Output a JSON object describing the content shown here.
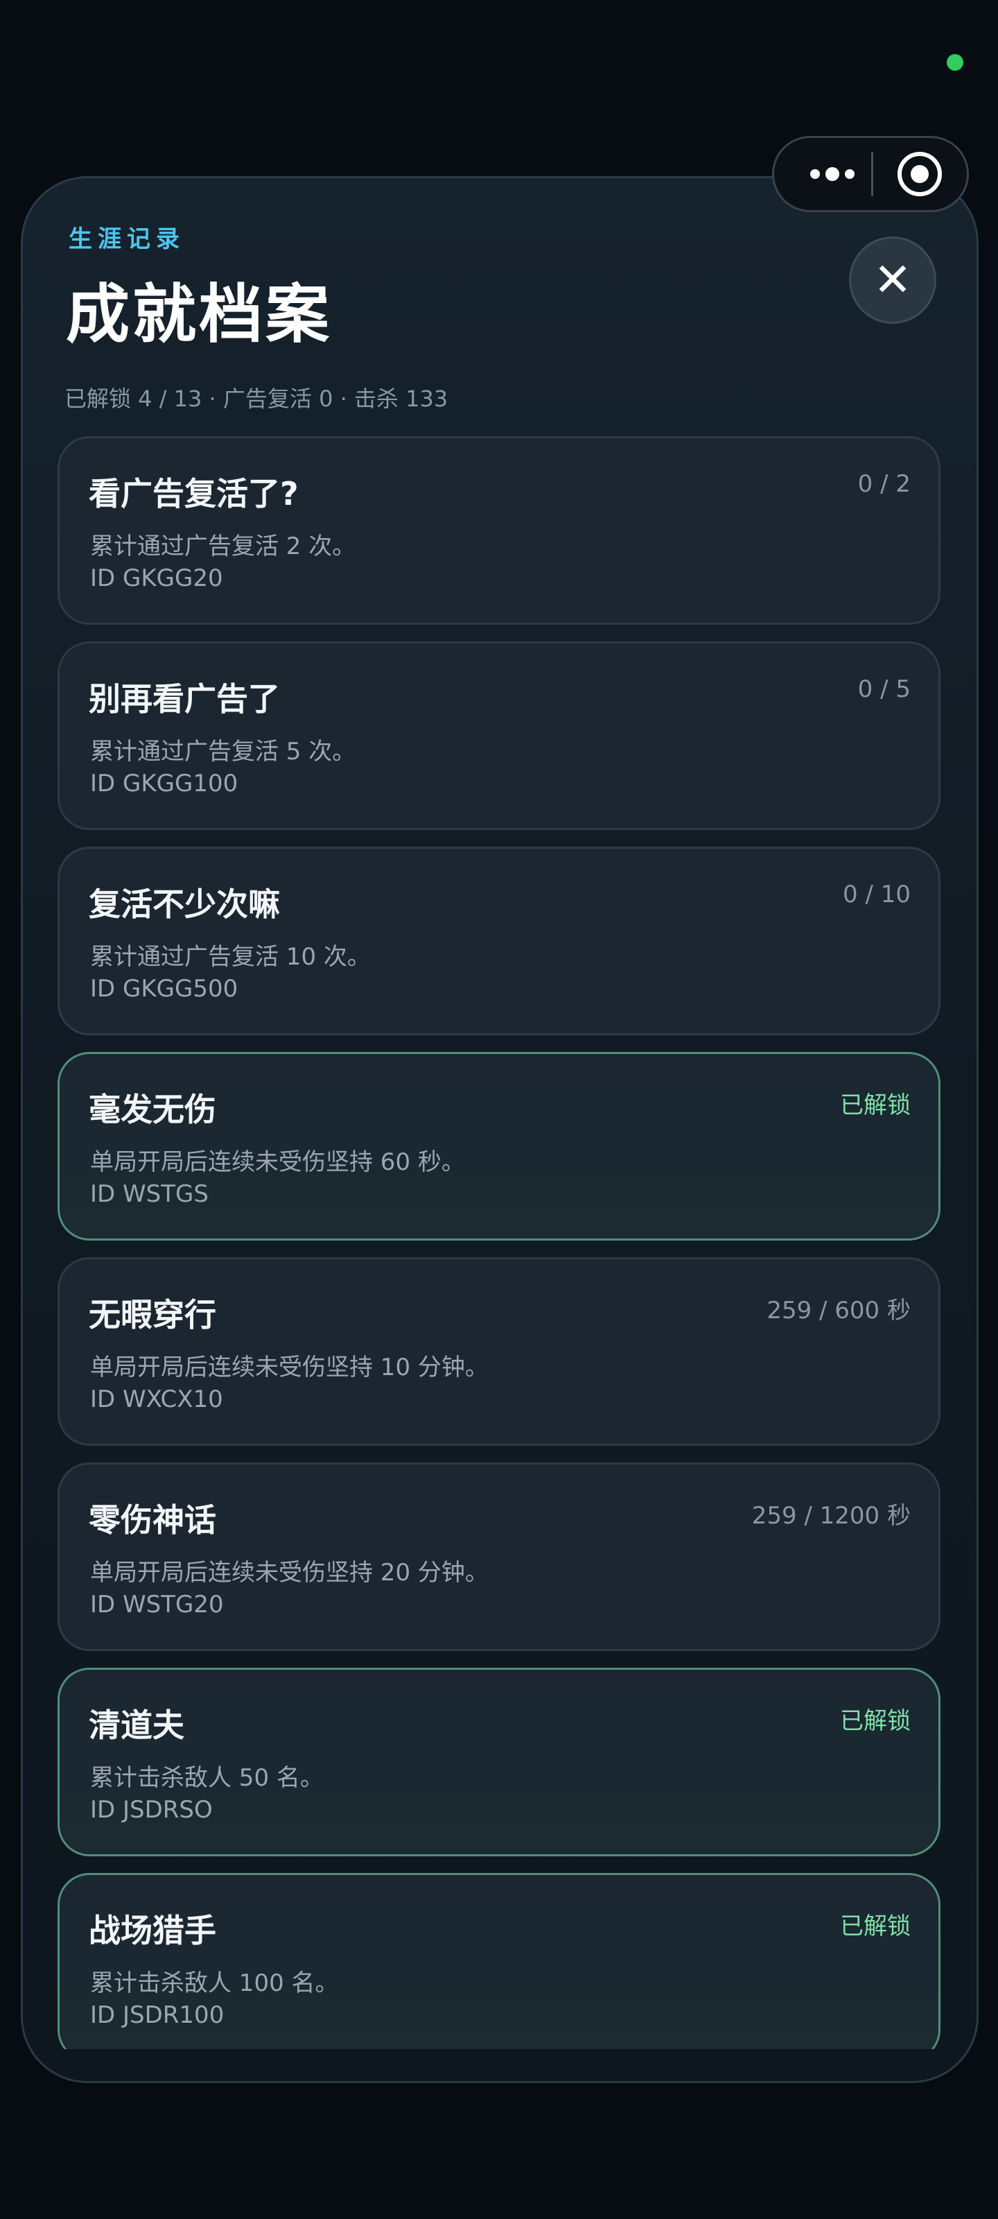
{
  "header": {
    "eyebrow": "生涯记录",
    "title": "成就档案",
    "close_label": "✕",
    "summary": "已解锁 4 / 13 · 广告复活 0 · 击杀 133"
  },
  "achievements": [
    {
      "title": "看广告复活了?",
      "progress": "0 / 2",
      "desc": "累计通过广告复活 2 次。",
      "id": "ID GKGG20",
      "unlocked": false
    },
    {
      "title": "别再看广告了",
      "progress": "0 / 5",
      "desc": "累计通过广告复活 5 次。",
      "id": "ID GKGG100",
      "unlocked": false
    },
    {
      "title": "复活不少次嘛",
      "progress": "0 / 10",
      "desc": "累计通过广告复活 10 次。",
      "id": "ID GKGG500",
      "unlocked": false
    },
    {
      "title": "毫发无伤",
      "progress": "已解锁",
      "desc": "单局开局后连续未受伤坚持 60 秒。",
      "id": "ID WSTGS",
      "unlocked": true
    },
    {
      "title": "无暇穿行",
      "progress": "259 / 600 秒",
      "desc": "单局开局后连续未受伤坚持 10 分钟。",
      "id": "ID WXCX10",
      "unlocked": false
    },
    {
      "title": "零伤神话",
      "progress": "259 / 1200 秒",
      "desc": "单局开局后连续未受伤坚持 20 分钟。",
      "id": "ID WSTG20",
      "unlocked": false
    },
    {
      "title": "清道夫",
      "progress": "已解锁",
      "desc": "累计击杀敌人 50 名。",
      "id": "ID JSDRSO",
      "unlocked": true
    },
    {
      "title": "战场猎手",
      "progress": "已解锁",
      "desc": "累计击杀敌人 100 名。",
      "id": "ID JSDR100",
      "unlocked": true
    }
  ],
  "colors": {
    "accent": "#4cc6ee",
    "unlocked": "#7fe0a8",
    "status_dot": "#2fce5f"
  },
  "icons": {
    "capsule_menu": "more-dots-icon",
    "capsule_close": "target-circle-icon",
    "close": "close-icon"
  }
}
